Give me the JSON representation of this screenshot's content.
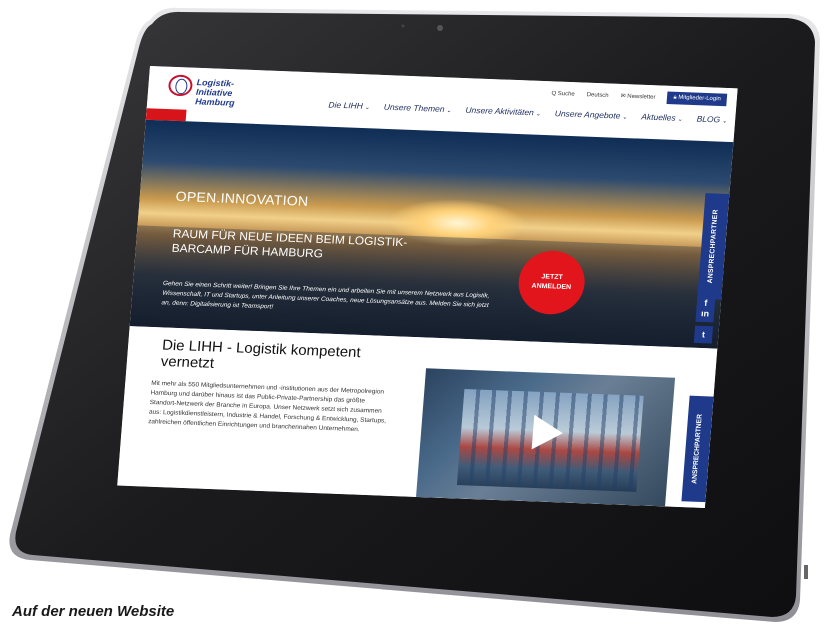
{
  "caption": "Auf der neuen Website",
  "site": {
    "logo_text": "Logistik-Initiative Hamburg",
    "utility": {
      "search": "Q Suche",
      "language": "Deutsch",
      "newsletter": "Newsletter",
      "login": "Mitglieder-Login"
    },
    "nav": [
      {
        "label": "Die LIHH"
      },
      {
        "label": "Unsere Themen"
      },
      {
        "label": "Unsere Aktivitäten"
      },
      {
        "label": "Unsere Angebote"
      },
      {
        "label": "Aktuelles"
      },
      {
        "label": "BLOG"
      }
    ],
    "hero": {
      "title": "OPEN.INNOVATION",
      "subtitle": "RAUM FÜR NEUE IDEEN BEIM LOGISTIK-BARCAMP FÜR HAMBURG",
      "body": "Gehen Sie einen Schritt weiter! Bringen Sie Ihre Themen ein und arbeiten Sie mit unserem Netzwerk aus Logistik, Wissenschaft, IT und Startups, unter Anleitung unserer Coaches, neue Lösungsansätze aus. Melden Sie sich jetzt an, denn: Digitalisierung ist Teamsport!",
      "cta": "JETZT ANMELDEN"
    },
    "side_tab": "ANSPRECHPARTNER",
    "social": [
      "in",
      "t",
      "f"
    ],
    "content": {
      "heading": "Die LIHH - Logistik kompetent vernetzt",
      "paragraph": "Mit mehr als 550 Mitgliedsunternehmen und -institutionen aus der Metropolregion Hamburg und darüber hinaus ist das Public-Private-Partnership das größte Standort-Netzwerk der Branche in Europa. Unser Netzwerk setzt sich zusammen aus: Logistikdienstleistern, Industrie & Handel, Forschung & Entwicklung, Startups, zahlreichen öffentlichen Einrichtungen und branchennahen Unternehmen."
    }
  }
}
